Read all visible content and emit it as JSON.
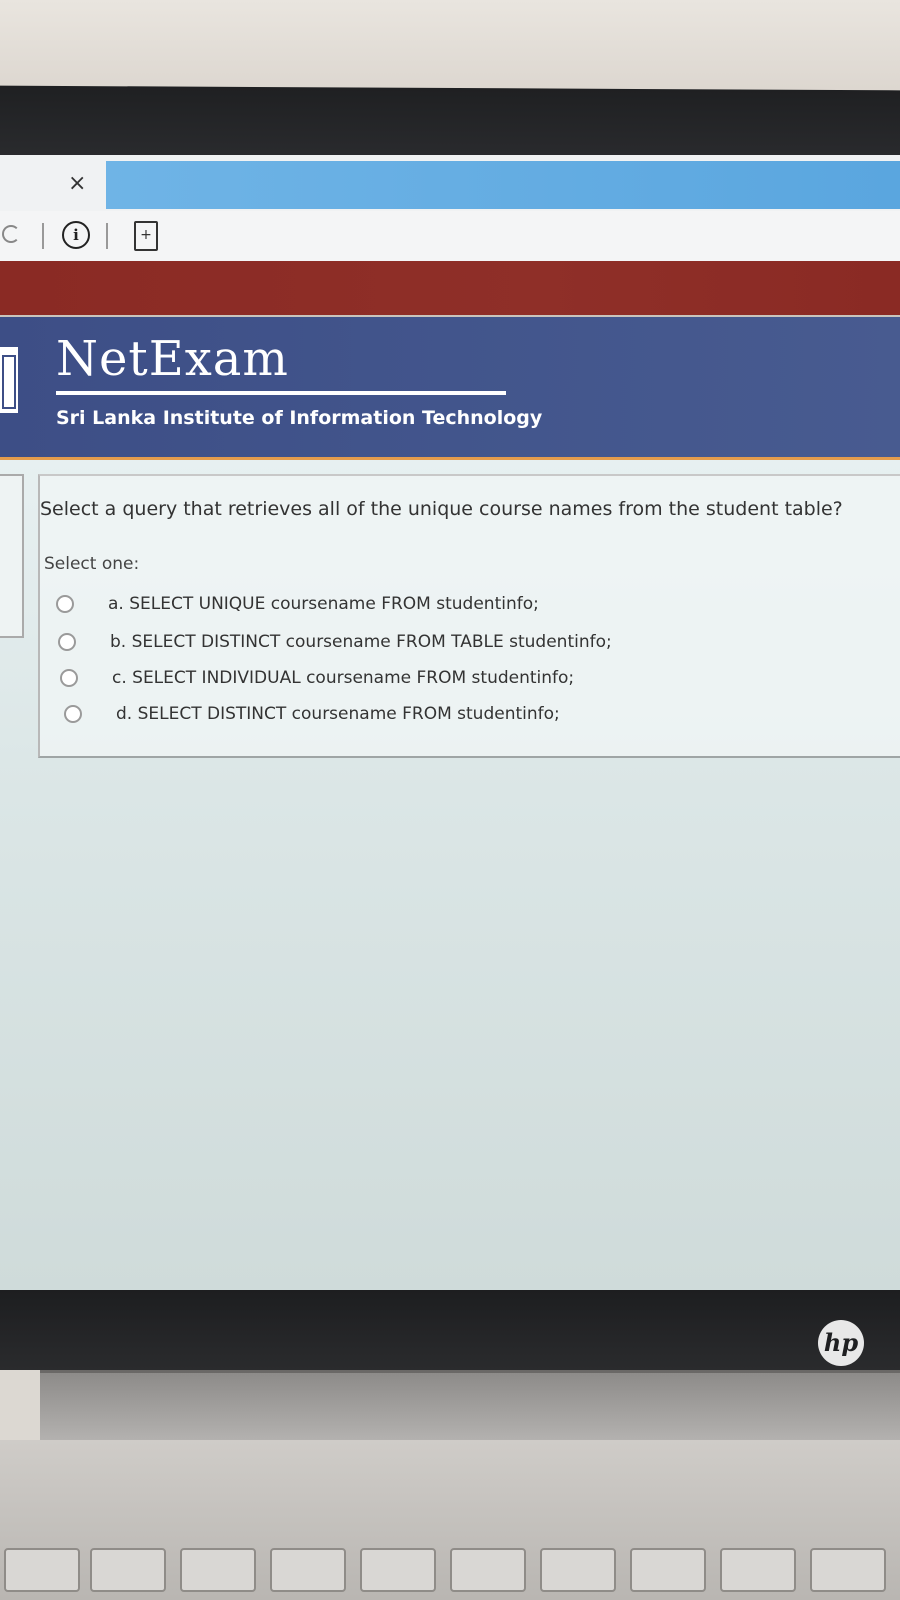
{
  "header": {
    "app_title": "NetExam",
    "subtitle": "Sri Lanka Institute of Information Technology"
  },
  "browser": {
    "close_glyph": "×",
    "info_glyph": "i",
    "bookmark_glyph": "+"
  },
  "question": {
    "text": "Select a query that retrieves all of the unique course names from the student table?",
    "prompt": "Select one:",
    "options": [
      {
        "label": "a. SELECT UNIQUE coursename FROM studentinfo;"
      },
      {
        "label": "b. SELECT DISTINCT coursename FROM TABLE studentinfo;"
      },
      {
        "label": "c. SELECT INDIVIDUAL coursename FROM studentinfo;"
      },
      {
        "label": "d. SELECT DISTINCT coursename FROM studentinfo;"
      }
    ]
  },
  "device": {
    "brand": "hp"
  },
  "colors": {
    "header_blue": "#42558c",
    "band_red": "#8a2a24",
    "accent_orange": "#e49c4c",
    "tab_blue": "#5aa6df"
  }
}
